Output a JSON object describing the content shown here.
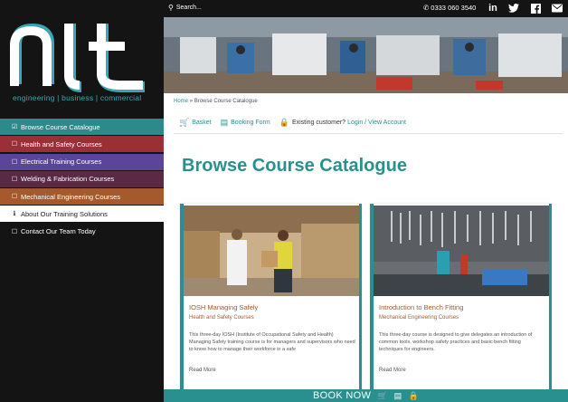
{
  "logo": {
    "tagline": "engineering | business | commercial"
  },
  "topbar": {
    "search_placeholder": "Search...",
    "phone": "0333 060 3540",
    "social": [
      "linkedin-icon",
      "twitter-icon",
      "facebook-icon",
      "email-icon"
    ]
  },
  "sidebar": {
    "items": [
      {
        "label": "Browse Course Catalogue",
        "icon": "checkbox-checked"
      },
      {
        "label": "Health and Safety Courses",
        "icon": "checkbox"
      },
      {
        "label": "Electrical Training Courses",
        "icon": "checkbox"
      },
      {
        "label": "Welding & Fabrication Courses",
        "icon": "checkbox"
      },
      {
        "label": "Mechanical Engineering Courses",
        "icon": "checkbox"
      },
      {
        "label": "About Our Training Solutions",
        "icon": "info"
      },
      {
        "label": "Contact Our Team Today",
        "icon": "checkbox"
      }
    ]
  },
  "breadcrumb": {
    "home": "Home",
    "separator": "»",
    "current": "Browse Course Catalogue"
  },
  "quicklinks": {
    "basket": "Basket",
    "booking_form": "Booking Form",
    "existing_customer": "Existing customer?",
    "login": "Login / View Account"
  },
  "page": {
    "title": "Browse Course Catalogue"
  },
  "cards": [
    {
      "title": "IOSH Managing Safely",
      "subtitle": "Health and Safety Courses",
      "desc": "This three-day IOSH (Institute of Occupational Safety and Health) Managing Safely training course is for managers and supervisors who need to know how to manage their workforce in a safe",
      "more": "Read More"
    },
    {
      "title": "Introduction to Bench Fitting",
      "subtitle": "Mechanical Engineering Courses",
      "desc": "This three-day course is designed to give delegates an introduction of common tools, workshop safety practices and basic bench fitting techniques for engineers.",
      "more": "Read More"
    }
  ],
  "booknow": {
    "label": "BOOK NOW"
  },
  "colors": {
    "teal": "#2a8f8f",
    "dark": "#141414",
    "orange": "#a55a2e"
  }
}
